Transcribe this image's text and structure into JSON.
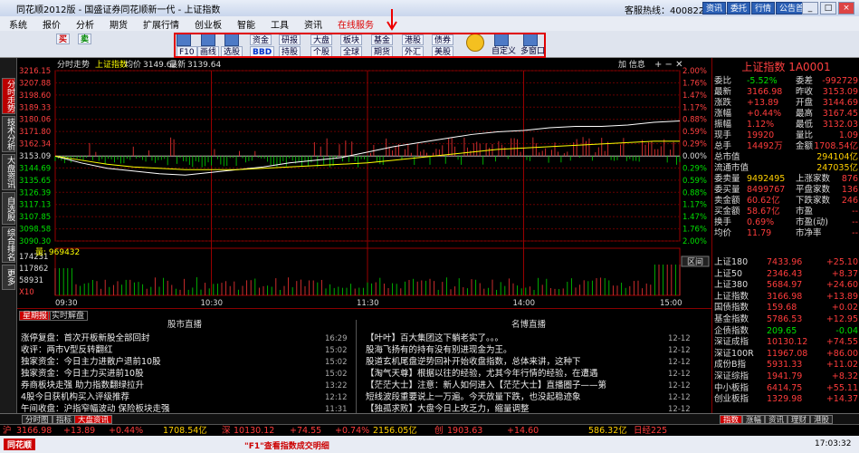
{
  "window": {
    "title": "同花顺2012版 - 国盛证券同花顺新一代 - 上证指数",
    "hotline": "客服热线：4008221111",
    "top_buttons": [
      "资讯",
      "委托",
      "行情",
      "公告首页"
    ]
  },
  "menu": [
    "系统",
    "报价",
    "分析",
    "期货",
    "扩展行情",
    "创业板",
    "智能",
    "工具",
    "资讯",
    "在线服务"
  ],
  "menu_highlight": "在线服务",
  "toolbar": {
    "left_buttons": [
      "买",
      "卖",
      "F10",
      "画线",
      "选股"
    ],
    "groups": [
      [
        "资金",
        "BBD"
      ],
      [
        "研报",
        "持股"
      ],
      [
        "大盘",
        "个股"
      ],
      [
        "板块",
        "全球"
      ],
      [
        "基金",
        "期货"
      ],
      [
        "港股",
        "外汇"
      ],
      [
        "债券",
        "美股"
      ]
    ],
    "right_buttons": [
      "自定义",
      "多窗口"
    ]
  },
  "vtabs": [
    {
      "label": "分时走势",
      "active": true
    },
    {
      "label": "技术分析",
      "active": false
    },
    {
      "label": "大盘资讯",
      "active": false
    },
    {
      "label": "自选股",
      "active": false
    },
    {
      "label": "综合排名",
      "active": false
    },
    {
      "label": "更多",
      "active": false
    }
  ],
  "chart_header": {
    "left": "分时走势",
    "index": "上证指数",
    "ma_label": "均价",
    "ma_value": "3149.62",
    "latest_label": "最新",
    "latest_value": "3139.64",
    "right": "加 信息"
  },
  "chart_data": {
    "type": "line",
    "title": "上证指数 分时走势",
    "y_ticks": [
      "3216.15",
      "3207.88",
      "3198.60",
      "3189.33",
      "3180.06",
      "3171.80",
      "3162.34",
      "3153.09",
      "3144.69",
      "3135.65",
      "3126.39",
      "3117.13",
      "3107.85",
      "3098.58",
      "3090.30"
    ],
    "y_ticks_right": [
      "2.00%",
      "1.76%",
      "1.47%",
      "1.17%",
      "0.88%",
      "0.59%",
      "0.29%",
      "0.00%",
      "0.29%",
      "0.59%",
      "0.88%",
      "1.17%",
      "1.47%",
      "1.76%",
      "2.00%"
    ],
    "x_ticks": [
      "09:30",
      "10:30",
      "11:30",
      "14:00",
      "15:00"
    ],
    "volume_label": "量: 969432",
    "volume_ticks": [
      "174231",
      "117862",
      "58931",
      "X10"
    ],
    "volume_right": "区间",
    "ylim": [
      3090.3,
      3216.15
    ],
    "base": 3153.09,
    "series": [
      {
        "name": "指数",
        "color": "#ffffff",
        "x": [
          0,
          10,
          20,
          30,
          40,
          50,
          60,
          70,
          80,
          90,
          100,
          110,
          120,
          130,
          140,
          150,
          160,
          170,
          180,
          190,
          200,
          210,
          220,
          230,
          240
        ],
        "values": [
          3153,
          3148,
          3144,
          3142,
          3140,
          3139,
          3141,
          3143,
          3145,
          3148,
          3150,
          3152,
          3156,
          3160,
          3163,
          3166,
          3169,
          3171,
          3172,
          3174,
          3175,
          3175,
          3176,
          3178,
          3179
        ]
      },
      {
        "name": "均价",
        "color": "#ffff00",
        "x": [
          0,
          10,
          20,
          30,
          40,
          50,
          60,
          70,
          80,
          90,
          100,
          110,
          120,
          130,
          140,
          150,
          160,
          170,
          180,
          190,
          200,
          210,
          220,
          230,
          240
        ],
        "values": [
          3153,
          3150,
          3147,
          3145,
          3144,
          3143,
          3143,
          3143,
          3144,
          3145,
          3146,
          3147,
          3148,
          3150,
          3152,
          3154,
          3156,
          3158,
          3159,
          3160,
          3161,
          3162,
          3163,
          3164,
          3164
        ]
      }
    ]
  },
  "quote": {
    "title": "上证指数 1A0001",
    "rows": [
      [
        "委比",
        "-5.52%",
        "委差",
        "-992729"
      ],
      [
        "最新",
        "3166.98",
        "昨收",
        "3153.09"
      ],
      [
        "涨跌",
        "+13.89",
        "开盘",
        "3144.69"
      ],
      [
        "涨幅",
        "+0.44%",
        "最高",
        "3167.45"
      ],
      [
        "振幅",
        "1.12%",
        "最低",
        "3132.03"
      ],
      [
        "现手",
        "19920",
        "量比",
        "1.09"
      ],
      [
        "总手",
        "14492万",
        "金额",
        "1708.54亿"
      ],
      [
        "总市值",
        "",
        "",
        "294104亿"
      ],
      [
        "流通市值",
        "",
        "",
        "247035亿"
      ],
      [
        "委卖量",
        "9492495",
        "上涨家数",
        "876"
      ],
      [
        "委买量",
        "8499767",
        "平盘家数",
        "136"
      ],
      [
        "卖金额",
        "60.62亿",
        "下跌家数",
        "246"
      ],
      [
        "买金额",
        "58.67亿",
        "市盈",
        "--"
      ],
      [
        "换手",
        "0.69%",
        "市盈(动)",
        "--"
      ],
      [
        "均价",
        "11.79",
        "市净率",
        "--"
      ]
    ],
    "indices": [
      [
        "上证180",
        "7433.96",
        "+25.10"
      ],
      [
        "上证50",
        "2346.43",
        "+8.37"
      ],
      [
        "上证380",
        "5684.97",
        "+24.60"
      ],
      [
        "上证指数",
        "3166.98",
        "+13.89"
      ],
      [
        "国债指数",
        "159.68",
        "+0.02"
      ],
      [
        "基金指数",
        "5786.53",
        "+12.95"
      ],
      [
        "企债指数",
        "209.65",
        "-0.04"
      ],
      [
        "深证成指",
        "10130.12",
        "+74.55"
      ],
      [
        "深证100R",
        "11967.08",
        "+86.00"
      ],
      [
        "成份B指",
        "5931.33",
        "+11.02"
      ],
      [
        "深证综指",
        "1941.79",
        "+8.32"
      ],
      [
        "中小板指",
        "6414.75",
        "+55.11"
      ],
      [
        "创业板指",
        "1329.98",
        "+14.37"
      ]
    ]
  },
  "news": {
    "tabs": [
      "星期报",
      "实时解盘"
    ],
    "left_title": "股市直播",
    "right_title": "名博直播",
    "left": [
      [
        "涨停复盘：首次开板新股全部回封",
        "16:29"
      ],
      [
        "收评：两市V型反转翻红",
        "15:02"
      ],
      [
        "独家资金：今日主力进散户退前10股",
        "15:02"
      ],
      [
        "独家资金：今日主力买进前10股",
        "15:02"
      ],
      [
        "券商板块走强 助力指数翻绿拉升",
        "13:22"
      ],
      [
        "4股今日获机构买入评级推荐",
        "12:12"
      ],
      [
        "午间收盘：沪指窄幅波动 保险板块走强",
        "11:31"
      ]
    ],
    "right": [
      [
        "【叶叶】百大集团这下躺老实了。。。",
        "12-12"
      ],
      [
        "股海飞扬有的持有没有别进现金为王。",
        "12-12"
      ],
      [
        "股道玄机尾盘逆势回补开始收盘指数，总体来讲，这种下",
        "12-12"
      ],
      [
        "【淘气天尊】根据以往的经验，尤其今年行情的经验，在遭遇",
        "12-12"
      ],
      [
        "【茫茫大士】注意：新人如何进入【茫茫大士】直播圈子——第",
        "12-12"
      ],
      [
        "短线波段重要说上一万遍。今天放量下跌，也没起稳迹象",
        "12-12"
      ],
      [
        "【独孤求败】大盘今日上攻乏力，缩量调整",
        "12-12"
      ]
    ]
  },
  "bottom_tabs": [
    "分时图",
    "指标",
    "大盘资讯"
  ],
  "bottom_tabs_right": [
    "指数",
    "涨幅",
    "资讯",
    "理财",
    "港股"
  ],
  "ticker": {
    "sh_label": "沪",
    "sh_value": "3166.98",
    "sh_change": "+13.89",
    "sh_pct": "+0.44%",
    "sh_amount": "1708.54亿",
    "sz_label": "深",
    "sz_value": "10130.12",
    "sz_change": "+74.55",
    "sz_pct": "+0.74%",
    "sz_amount": "2156.05亿",
    "cy_label": "创",
    "cy_value": "1903.63",
    "cy_change": "+14.60",
    "cy_amount": "586.32亿",
    "misc": "日经225"
  },
  "status": {
    "left": "同花顺",
    "center": "\"F1\"查看指数成交明细",
    "time": "17:03:32"
  }
}
